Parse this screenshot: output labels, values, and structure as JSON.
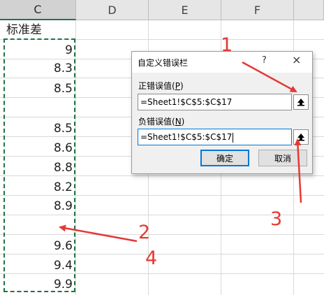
{
  "columns": [
    "C",
    "D",
    "E",
    "F"
  ],
  "cells": {
    "header": "标准差",
    "values": [
      "9",
      "8.3",
      "8.5",
      "",
      "8.5",
      "8.6",
      "8.8",
      "8.2",
      "8.9",
      "",
      "9.6",
      "9.4",
      "9.9"
    ]
  },
  "dialog": {
    "title": "自定义错误栏",
    "help": "?",
    "close": "×",
    "positive_label": "正错误值(",
    "positive_key": "P",
    "negative_label": "负错误值(",
    "negative_key": "N",
    "label_end": ")",
    "positive_value": "=Sheet1!$C$5:$C$17",
    "negative_value": "=Sheet1!$C$5:$C$17",
    "ok": "确定",
    "cancel": "取消"
  },
  "annotations": [
    "1",
    "2",
    "3",
    "4"
  ],
  "colors": {
    "annotation": "#e53935",
    "accent": "#217346",
    "focus": "#0078d7"
  }
}
